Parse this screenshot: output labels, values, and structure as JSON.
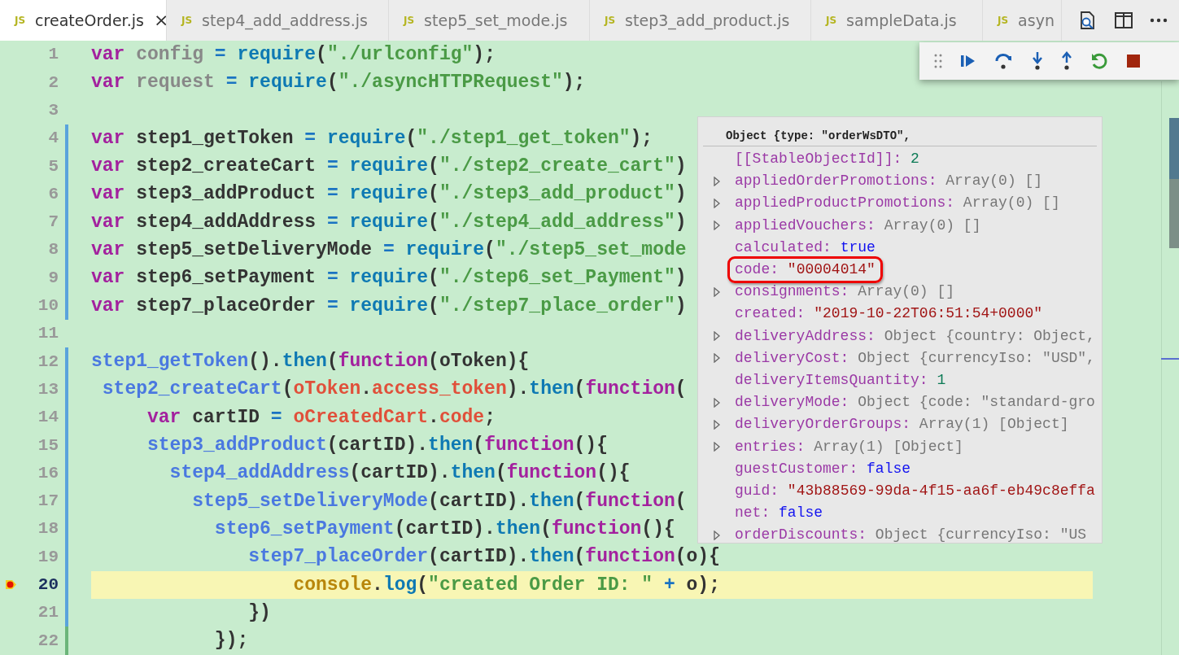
{
  "editor_tabs": {
    "close_label": "×",
    "items": [
      {
        "badge": "JS",
        "label": "createOrder.js",
        "selected": true
      },
      {
        "badge": "JS",
        "label": "step4_add_address.js",
        "selected": false
      },
      {
        "badge": "JS",
        "label": "step5_set_mode.js",
        "selected": false
      },
      {
        "badge": "JS",
        "label": "step3_add_product.js",
        "selected": false
      },
      {
        "badge": "JS",
        "label": "sampleData.js",
        "selected": false
      },
      {
        "badge": "JS",
        "label": "asyn",
        "selected": false
      }
    ]
  },
  "code_lines": [
    {
      "number": "1",
      "kind": "plain",
      "breakpoint": false,
      "current": false,
      "tokens": [
        {
          "kind": "kw",
          "text": "var"
        },
        {
          "kind": "dim",
          "text": " config "
        },
        {
          "kind": "op",
          "text": "="
        },
        {
          "kind": "fn",
          "text": " require"
        },
        {
          "kind": "p",
          "text": "("
        },
        {
          "kind": "str",
          "text": "\"./urlconfig\""
        },
        {
          "kind": "p",
          "text": ");"
        }
      ]
    },
    {
      "number": "2",
      "kind": "plain",
      "breakpoint": false,
      "current": false,
      "tokens": [
        {
          "kind": "kw",
          "text": "var"
        },
        {
          "kind": "dim",
          "text": " request "
        },
        {
          "kind": "op",
          "text": "="
        },
        {
          "kind": "fn",
          "text": " require"
        },
        {
          "kind": "p",
          "text": "("
        },
        {
          "kind": "str",
          "text": "\"./asyncHTTPRequest\""
        },
        {
          "kind": "p",
          "text": ");"
        }
      ]
    },
    {
      "number": "3",
      "kind": "plain",
      "breakpoint": false,
      "current": false
    },
    {
      "number": "4",
      "kind": "modified",
      "breakpoint": false,
      "current": false,
      "tokens": [
        {
          "kind": "kw",
          "text": "var"
        },
        {
          "kind": "p",
          "text": " step1_getToken "
        },
        {
          "kind": "op",
          "text": "="
        },
        {
          "kind": "fn",
          "text": " require"
        },
        {
          "kind": "p",
          "text": "("
        },
        {
          "kind": "str",
          "text": "\"./step1_get_token\""
        },
        {
          "kind": "p",
          "text": ");"
        }
      ]
    },
    {
      "number": "5",
      "kind": "modified",
      "breakpoint": false,
      "current": false,
      "tokens": [
        {
          "kind": "kw",
          "text": "var"
        },
        {
          "kind": "p",
          "text": " step2_createCart "
        },
        {
          "kind": "op",
          "text": "="
        },
        {
          "kind": "fn",
          "text": " require"
        },
        {
          "kind": "p",
          "text": "("
        },
        {
          "kind": "str",
          "text": "\"./step2_create_cart\""
        },
        {
          "kind": "p",
          "text": ")"
        }
      ]
    },
    {
      "number": "6",
      "kind": "modified",
      "breakpoint": false,
      "current": false,
      "tokens": [
        {
          "kind": "kw",
          "text": "var"
        },
        {
          "kind": "p",
          "text": " step3_addProduct "
        },
        {
          "kind": "op",
          "text": "="
        },
        {
          "kind": "fn",
          "text": " require"
        },
        {
          "kind": "p",
          "text": "("
        },
        {
          "kind": "str",
          "text": "\"./step3_add_product\""
        },
        {
          "kind": "p",
          "text": ")"
        }
      ]
    },
    {
      "number": "7",
      "kind": "modified",
      "breakpoint": false,
      "current": false,
      "tokens": [
        {
          "kind": "kw",
          "text": "var"
        },
        {
          "kind": "p",
          "text": " step4_addAddress "
        },
        {
          "kind": "op",
          "text": "="
        },
        {
          "kind": "fn",
          "text": " require"
        },
        {
          "kind": "p",
          "text": "("
        },
        {
          "kind": "str",
          "text": "\"./step4_add_address\""
        },
        {
          "kind": "p",
          "text": ")"
        }
      ]
    },
    {
      "number": "8",
      "kind": "modified",
      "breakpoint": false,
      "current": false,
      "tokens": [
        {
          "kind": "kw",
          "text": "var"
        },
        {
          "kind": "p",
          "text": " step5_setDeliveryMode "
        },
        {
          "kind": "op",
          "text": "="
        },
        {
          "kind": "fn",
          "text": " require"
        },
        {
          "kind": "p",
          "text": "("
        },
        {
          "kind": "str",
          "text": "\"./step5_set_mode"
        }
      ]
    },
    {
      "number": "9",
      "kind": "modified",
      "breakpoint": false,
      "current": false,
      "tokens": [
        {
          "kind": "kw",
          "text": "var"
        },
        {
          "kind": "p",
          "text": " step6_setPayment "
        },
        {
          "kind": "op",
          "text": "="
        },
        {
          "kind": "fn",
          "text": " require"
        },
        {
          "kind": "p",
          "text": "("
        },
        {
          "kind": "str",
          "text": "\"./step6_set_Payment\""
        },
        {
          "kind": "p",
          "text": ")"
        }
      ]
    },
    {
      "number": "10",
      "kind": "modified",
      "breakpoint": false,
      "current": false,
      "tokens": [
        {
          "kind": "kw",
          "text": "var"
        },
        {
          "kind": "p",
          "text": " step7_placeOrder "
        },
        {
          "kind": "op",
          "text": "="
        },
        {
          "kind": "fn",
          "text": " require"
        },
        {
          "kind": "p",
          "text": "("
        },
        {
          "kind": "str",
          "text": "\"./step7_place_order\""
        },
        {
          "kind": "p",
          "text": ")"
        }
      ]
    },
    {
      "number": "11",
      "kind": "plain",
      "breakpoint": false,
      "current": false
    },
    {
      "number": "12",
      "kind": "modified",
      "breakpoint": false,
      "current": false,
      "tokens": [
        {
          "kind": "call",
          "text": "step1_getToken"
        },
        {
          "kind": "p",
          "text": "()."
        },
        {
          "kind": "fn",
          "text": "then"
        },
        {
          "kind": "p",
          "text": "("
        },
        {
          "kind": "kw",
          "text": "function"
        },
        {
          "kind": "p",
          "text": "(oToken){"
        }
      ]
    },
    {
      "number": "13",
      "kind": "modified",
      "breakpoint": false,
      "current": false,
      "tokens": [
        {
          "kind": "call",
          "text": " step2_createCart"
        },
        {
          "kind": "p",
          "text": "("
        },
        {
          "kind": "red",
          "text": "oToken"
        },
        {
          "kind": "p",
          "text": "."
        },
        {
          "kind": "red",
          "text": "access_token"
        },
        {
          "kind": "p",
          "text": ")."
        },
        {
          "kind": "fn",
          "text": "then"
        },
        {
          "kind": "p",
          "text": "("
        },
        {
          "kind": "kw",
          "text": "function"
        },
        {
          "kind": "p",
          "text": "("
        }
      ]
    },
    {
      "number": "14",
      "kind": "modified",
      "breakpoint": false,
      "current": false,
      "tokens": [
        {
          "kind": "kw",
          "text": "     var"
        },
        {
          "kind": "p",
          "text": " cartID "
        },
        {
          "kind": "op",
          "text": "="
        },
        {
          "kind": "red",
          "text": " oCreatedCart"
        },
        {
          "kind": "p",
          "text": "."
        },
        {
          "kind": "red",
          "text": "code"
        },
        {
          "kind": "p",
          "text": ";"
        }
      ]
    },
    {
      "number": "15",
      "kind": "modified",
      "breakpoint": false,
      "current": false,
      "tokens": [
        {
          "kind": "call",
          "text": "     step3_addProduct"
        },
        {
          "kind": "p",
          "text": "(cartID)."
        },
        {
          "kind": "fn",
          "text": "then"
        },
        {
          "kind": "p",
          "text": "("
        },
        {
          "kind": "kw",
          "text": "function"
        },
        {
          "kind": "p",
          "text": "(){"
        }
      ]
    },
    {
      "number": "16",
      "kind": "modified",
      "breakpoint": false,
      "current": false,
      "tokens": [
        {
          "kind": "call",
          "text": "       step4_addAddress"
        },
        {
          "kind": "p",
          "text": "(cartID)."
        },
        {
          "kind": "fn",
          "text": "then"
        },
        {
          "kind": "p",
          "text": "("
        },
        {
          "kind": "kw",
          "text": "function"
        },
        {
          "kind": "p",
          "text": "(){"
        }
      ]
    },
    {
      "number": "17",
      "kind": "modified",
      "breakpoint": false,
      "current": false,
      "tokens": [
        {
          "kind": "call",
          "text": "         step5_setDeliveryMode"
        },
        {
          "kind": "p",
          "text": "(cartID)."
        },
        {
          "kind": "fn",
          "text": "then"
        },
        {
          "kind": "p",
          "text": "("
        },
        {
          "kind": "kw",
          "text": "function"
        },
        {
          "kind": "p",
          "text": "("
        }
      ]
    },
    {
      "number": "18",
      "kind": "modified",
      "breakpoint": false,
      "current": false,
      "tokens": [
        {
          "kind": "call",
          "text": "           step6_setPayment"
        },
        {
          "kind": "p",
          "text": "(cartID)."
        },
        {
          "kind": "fn",
          "text": "then"
        },
        {
          "kind": "p",
          "text": "("
        },
        {
          "kind": "kw",
          "text": "function"
        },
        {
          "kind": "p",
          "text": "(){"
        }
      ]
    },
    {
      "number": "19",
      "kind": "modified",
      "breakpoint": false,
      "current": false,
      "tokens": [
        {
          "kind": "call",
          "text": "              step7_placeOrder"
        },
        {
          "kind": "p",
          "text": "(cartID)."
        },
        {
          "kind": "fn",
          "text": "then"
        },
        {
          "kind": "p",
          "text": "("
        },
        {
          "kind": "kw",
          "text": "function"
        },
        {
          "kind": "p",
          "text": "(o){"
        }
      ]
    },
    {
      "number": "20",
      "kind": "modified",
      "breakpoint": true,
      "current": true,
      "tokens": [
        {
          "kind": "glob",
          "text": "                  console"
        },
        {
          "kind": "p",
          "text": "."
        },
        {
          "kind": "fn",
          "text": "log"
        },
        {
          "kind": "p",
          "text": "("
        },
        {
          "kind": "str",
          "text": "\"created Order ID: \""
        },
        {
          "kind": "op",
          "text": " +"
        },
        {
          "kind": "p",
          "text": " o);"
        }
      ]
    },
    {
      "number": "21",
      "kind": "modified",
      "breakpoint": false,
      "current": false,
      "tokens": [
        {
          "kind": "p",
          "text": "              })"
        }
      ]
    },
    {
      "number": "22",
      "kind": "added",
      "breakpoint": false,
      "current": false,
      "tokens": [
        {
          "kind": "p",
          "text": "           });"
        }
      ]
    }
  ],
  "hover": {
    "title": "Object {type: \"orderWsDTO\",",
    "rows": [
      {
        "expandable": false,
        "highlighted": false,
        "key": "[[StableObjectId]]:",
        "value": "2",
        "kind": "number"
      },
      {
        "expandable": true,
        "highlighted": false,
        "key": "appliedOrderPromotions:",
        "value": "Array(0) []",
        "kind": "object"
      },
      {
        "expandable": true,
        "highlighted": false,
        "key": "appliedProductPromotions:",
        "value": "Array(0) []",
        "kind": "object"
      },
      {
        "expandable": true,
        "highlighted": false,
        "key": "appliedVouchers:",
        "value": "Array(0) []",
        "kind": "object"
      },
      {
        "expandable": false,
        "highlighted": false,
        "key": "calculated:",
        "value": "true",
        "kind": "bool"
      },
      {
        "expandable": false,
        "highlighted": true,
        "key": "code:",
        "value": "\"00004014\"",
        "kind": "string"
      },
      {
        "expandable": true,
        "highlighted": false,
        "key": "consignments:",
        "value": "Array(0) []",
        "kind": "object"
      },
      {
        "expandable": false,
        "highlighted": false,
        "key": "created:",
        "value": "\"2019-10-22T06:51:54+0000\"",
        "kind": "string"
      },
      {
        "expandable": true,
        "highlighted": false,
        "key": "deliveryAddress:",
        "value": "Object {country: Object,",
        "kind": "object"
      },
      {
        "expandable": true,
        "highlighted": false,
        "key": "deliveryCost:",
        "value": "Object {currencyIso: \"USD\",",
        "kind": "object"
      },
      {
        "expandable": false,
        "highlighted": false,
        "key": "deliveryItemsQuantity:",
        "value": "1",
        "kind": "number"
      },
      {
        "expandable": true,
        "highlighted": false,
        "key": "deliveryMode:",
        "value": "Object {code: \"standard-gro",
        "kind": "object"
      },
      {
        "expandable": true,
        "highlighted": false,
        "key": "deliveryOrderGroups:",
        "value": "Array(1) [Object]",
        "kind": "object"
      },
      {
        "expandable": true,
        "highlighted": false,
        "key": "entries:",
        "value": "Array(1) [Object]",
        "kind": "object"
      },
      {
        "expandable": false,
        "highlighted": false,
        "key": "guestCustomer:",
        "value": "false",
        "kind": "bool"
      },
      {
        "expandable": false,
        "highlighted": false,
        "key": "guid:",
        "value": "\"43b88569-99da-4f15-aa6f-eb49c8effa",
        "kind": "string"
      },
      {
        "expandable": false,
        "highlighted": false,
        "key": "net:",
        "value": "false",
        "kind": "bool"
      },
      {
        "expandable": true,
        "highlighted": false,
        "key": "orderDiscounts:",
        "value": "Object {currencyIso: \"US",
        "kind": "object"
      }
    ]
  }
}
